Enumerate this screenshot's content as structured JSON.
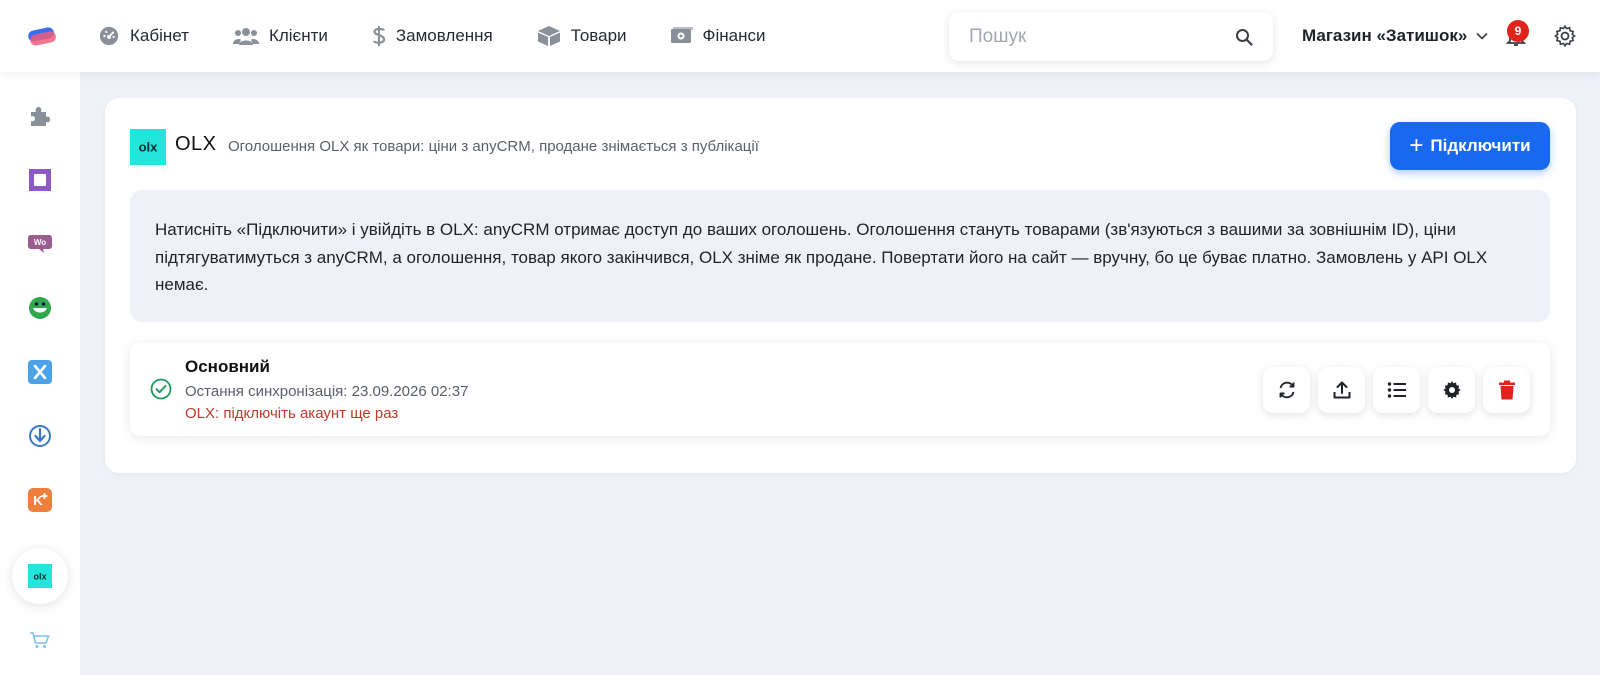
{
  "nav": {
    "items": [
      {
        "label": "Кабінет",
        "icon": "dashboard-icon"
      },
      {
        "label": "Клієнти",
        "icon": "users-icon"
      },
      {
        "label": "Замовлення",
        "icon": "dollar-icon"
      },
      {
        "label": "Товари",
        "icon": "box-icon"
      },
      {
        "label": "Фінанси",
        "icon": "money-icon"
      }
    ]
  },
  "search": {
    "placeholder": "Пошук",
    "value": ""
  },
  "store": {
    "name": "Магазин «Затишок»"
  },
  "notifications": {
    "count": "9"
  },
  "sidebar": {
    "items": [
      {
        "icon": "puzzle-icon",
        "active": false
      },
      {
        "icon": "square-app-icon",
        "active": false
      },
      {
        "icon": "woo-icon",
        "active": false
      },
      {
        "icon": "smile-app-icon",
        "active": false
      },
      {
        "icon": "x-app-icon",
        "active": false
      },
      {
        "icon": "download-app-icon",
        "active": false
      },
      {
        "icon": "k-plus-app-icon",
        "active": false
      },
      {
        "icon": "olx-app-icon",
        "active": true
      },
      {
        "icon": "cart-icon",
        "active": false
      }
    ]
  },
  "integration": {
    "logo_text": "olx",
    "title": "OLX",
    "description": "Оголошення OLX як товари: ціни з anyCRM, продане знімається з публікації",
    "connect_label": "Підключити",
    "info": "Натисніть «Підключити» і увійдіть в OLX: anyCRM отримає доступ до ваших оголошень. Оголошення стануть товарами (зв'язуються з вашими за зовнішнім ID), ціни підтягуватимуться з anyCRM, а оголошення, товар якого закінчився, OLX зніме як продане. Повертати його на сайт — вручну, бо це буває платно. Замовлень у API OLX немає."
  },
  "account": {
    "name": "Основний",
    "sync": "Остання синхронізація: 23.09.2026 02:37",
    "warning": "OLX: підключіть акаунт ще раз",
    "actions": [
      "sync-icon",
      "upload-icon",
      "list-icon",
      "gear-icon",
      "trash-icon"
    ]
  },
  "colors": {
    "accent": "#1868f0",
    "olx": "#23e5db",
    "danger": "#e0241c",
    "success": "#1a9a5a",
    "warning_text": "#c0392b"
  }
}
